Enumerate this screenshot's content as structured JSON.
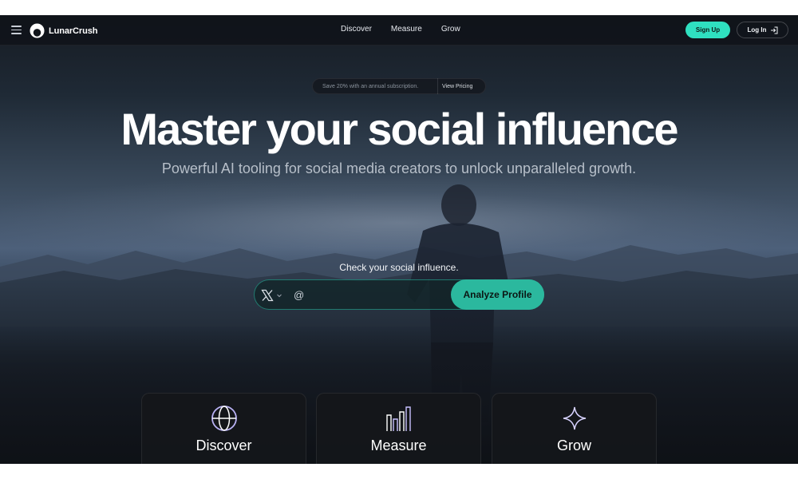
{
  "nav": {
    "logo_text": "LunarCrush",
    "links": [
      "Discover",
      "Measure",
      "Grow"
    ],
    "signup_label": "Sign Up",
    "login_label": "Log In"
  },
  "promo": {
    "text": "Save 20% with an annual subscription.",
    "link": "View Pricing"
  },
  "hero": {
    "headline": "Master your social influence",
    "subheadline": "Powerful AI tooling for social media creators to unlock unparalleled growth."
  },
  "analyzer": {
    "label": "Check your social influence.",
    "platform_icon": "x-logo-icon",
    "at_symbol": "@",
    "handle_value": "",
    "button_label": "Analyze Profile"
  },
  "cards": [
    {
      "label": "Discover",
      "icon": "globe-icon"
    },
    {
      "label": "Measure",
      "icon": "bar-chart-icon"
    },
    {
      "label": "Grow",
      "icon": "sparkle-icon"
    }
  ],
  "colors": {
    "accent": "#2fe0c0",
    "button": "#2bb89e",
    "background": "#161b22"
  }
}
